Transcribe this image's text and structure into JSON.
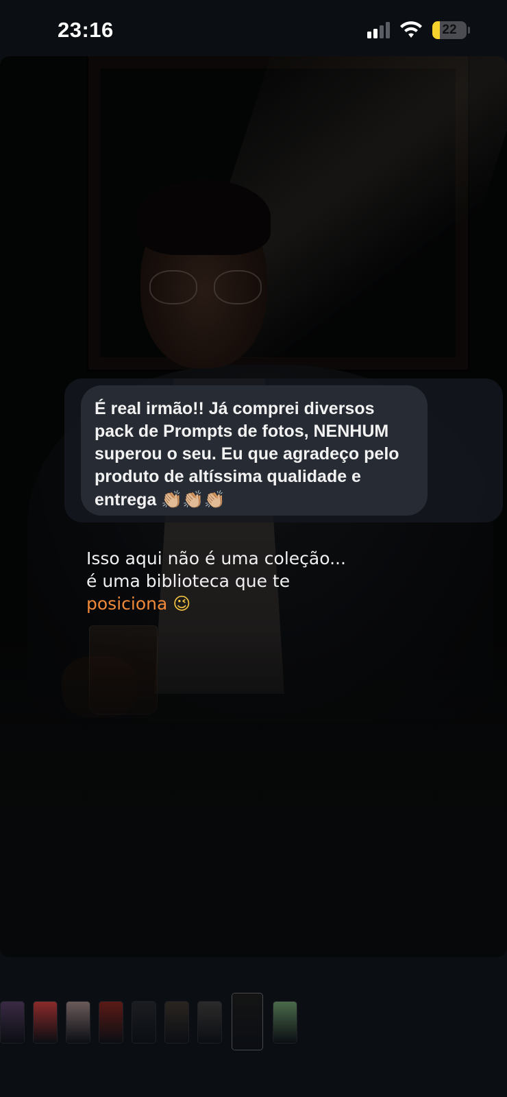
{
  "status_bar": {
    "time": "23:16",
    "battery_percent": "22",
    "battery_level": 0.22,
    "signal_icon": "cellular-signal-icon",
    "wifi_icon": "wifi-icon"
  },
  "story": {
    "message": {
      "text": "É real irmão!! Já comprei diversos\npack de Prompts de fotos, NENHUM\nsuperou o seu. Eu que agradeço pelo\nproduto de altíssima qualidade e\nentrega",
      "emoji": "👏🏼👏🏼👏🏼"
    },
    "caption": {
      "line1": "Isso aqui não é uma coleção...",
      "line2": "é uma biblioteca que te",
      "accent_word": "posiciona",
      "emoji": "😉",
      "accent_color": "#f08a3a"
    }
  },
  "thumbnails": [
    {
      "name": "story-thumb-1",
      "color": "#3a2a44"
    },
    {
      "name": "story-thumb-2",
      "color": "#8a2a2a"
    },
    {
      "name": "story-thumb-3",
      "color": "#6a5a5a"
    },
    {
      "name": "story-thumb-4",
      "color": "#5a1a16"
    },
    {
      "name": "story-thumb-5",
      "color": "#1a1c20"
    },
    {
      "name": "story-thumb-6",
      "color": "#2a2420"
    },
    {
      "name": "story-thumb-7",
      "color": "#2c2a2a"
    },
    {
      "name": "story-thumb-8",
      "color": "#141414",
      "active": true
    },
    {
      "name": "story-thumb-9",
      "color": "#4a6a4a"
    }
  ]
}
